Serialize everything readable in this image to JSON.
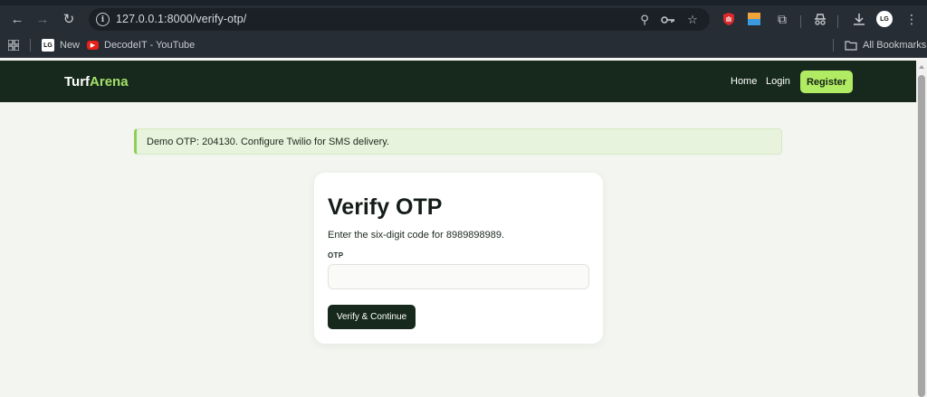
{
  "browser": {
    "url": "127.0.0.1:8000/verify-otp/",
    "bookmarks": [
      {
        "label": "New"
      },
      {
        "label": "DecodeIT - YouTube"
      }
    ],
    "all_bookmarks_label": "All Bookmarks",
    "profile_initials": "LG"
  },
  "site": {
    "brand_part1": "Turf",
    "brand_part2": "Arena",
    "nav": {
      "home": "Home",
      "login": "Login",
      "register": "Register"
    },
    "accent_color": "#b1ea63",
    "header_color": "#16291c"
  },
  "alert": {
    "message": "Demo OTP: 204130. Configure Twilio for SMS delivery."
  },
  "verify": {
    "title": "Verify OTP",
    "description": "Enter the six-digit code for 8989898989.",
    "field_label": "OTP",
    "field_value": "",
    "submit_label": "Verify & Continue"
  }
}
